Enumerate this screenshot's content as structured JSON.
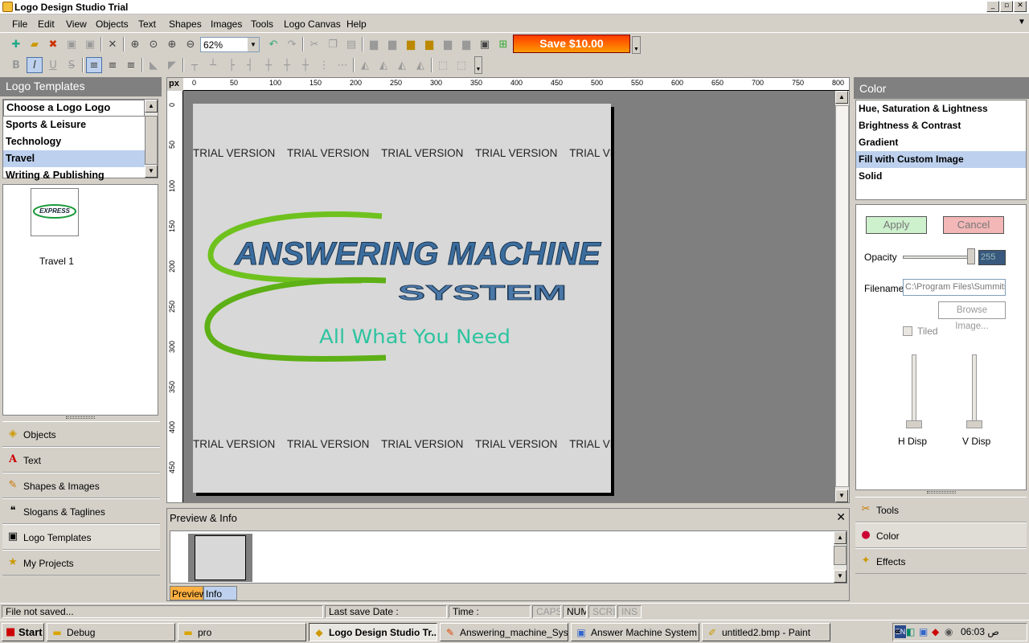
{
  "window": {
    "title": "Logo Design Studio Trial",
    "min": "_",
    "max": "▫",
    "close": "✕"
  },
  "menu": [
    "File",
    "Edit",
    "View",
    "Objects",
    "Text",
    "Shapes",
    "Images",
    "Tools",
    "Logo Canvas",
    "Help"
  ],
  "toolbar": {
    "zoom": "62%",
    "save_button": "Save $10.00"
  },
  "left_panel": {
    "title": "Logo Templates",
    "list_header": "Choose a Logo Logo",
    "categories": [
      "Sports & Leisure",
      "Technology",
      "Travel",
      "Writing & Publishing"
    ],
    "selected_category": "Travel",
    "thumbnail_label": "Travel 1",
    "thumbnail_text": "EXPRESS",
    "nav": [
      "Objects",
      "Text",
      "Shapes & Images",
      "Slogans & Taglines",
      "Logo Templates",
      "My Projects"
    ]
  },
  "canvas": {
    "ruler_unit": "px",
    "ruler_h": [
      "0",
      "50",
      "100",
      "150",
      "200",
      "250",
      "300",
      "350",
      "400",
      "450",
      "500",
      "550",
      "600",
      "650",
      "700",
      "750",
      "800"
    ],
    "ruler_v": [
      "0",
      "50",
      "100",
      "150",
      "200",
      "250",
      "300",
      "350",
      "400",
      "450"
    ],
    "watermark": "TRIAL VERSION",
    "headline": "ANSWERING MACHINE",
    "subheadline": "SYSTEM",
    "slogan": "All What You Need"
  },
  "preview": {
    "title": "Preview & Info",
    "tabs": [
      "Preview",
      "Info"
    ],
    "active_tab": "Preview"
  },
  "right_panel": {
    "title": "Color",
    "options": [
      "Hue, Saturation & Lightness",
      "Brightness & Contrast",
      "Gradient",
      "Fill with Custom Image",
      "Solid"
    ],
    "selected": "Fill with Custom Image",
    "apply": "Apply",
    "cancel": "Cancel",
    "opacity_label": "Opacity",
    "opacity_value": "255",
    "filename_label": "Filename",
    "filename_value": "C:\\Program Files\\Summits",
    "browse": "Browse Image...",
    "tiled": "Tiled",
    "h_disp": "H Disp",
    "v_disp": "V Disp",
    "nav": [
      "Tools",
      "Color",
      "Effects"
    ]
  },
  "status": {
    "file": "File not saved...",
    "last_save": "Last save Date :",
    "time": "Time :",
    "caps": "CAPS",
    "num": "NUM",
    "scrl": "SCRL",
    "ins": "INS"
  },
  "taskbar": {
    "start": "Start",
    "tasks": [
      "Debug",
      "pro",
      "Logo Design Studio Tr...",
      "Answering_machine_Sys...",
      "Answer Machine System ...",
      "untitled2.bmp - Paint"
    ],
    "active_task": "Logo Design Studio Tr...",
    "lang": "EN",
    "clock": "06:03 ص",
    "tray_arrow": "«"
  },
  "colors": {
    "accent": "#bdd1ee",
    "save_start": "#ff3a00",
    "save_end": "#ff9a00",
    "slogan": "#2ec4a0",
    "swoosh": "#6fc21e"
  }
}
